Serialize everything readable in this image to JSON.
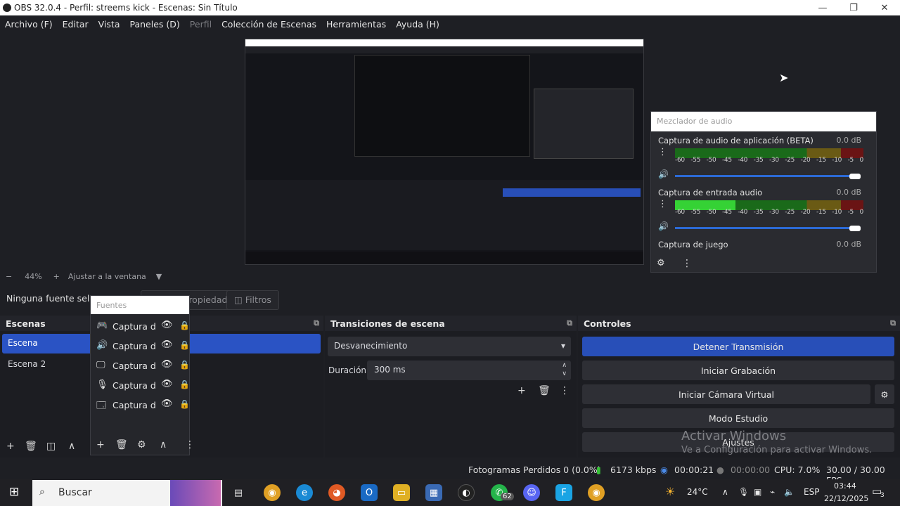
{
  "window": {
    "title": "OBS 32.0.4 - Perfil: streems kick - Escenas: Sin Título",
    "minimize": "—",
    "restore": "❐",
    "close": "✕"
  },
  "menu": [
    "Archivo (F)",
    "Editar",
    "Vista",
    "Paneles (D)",
    "Perfil",
    "Colección de Escenas",
    "Herramientas",
    "Ayuda (H)"
  ],
  "mixer": {
    "title": "Mezclador de audio",
    "channels": [
      {
        "name": "Captura de audio de aplicación (BETA)",
        "db": "0.0 dB",
        "level": 0.0
      },
      {
        "name": "Captura de entrada audio",
        "db": "0.0 dB",
        "level": 0.32
      },
      {
        "name": "Captura de juego",
        "db": "0.0 dB",
        "level": 0.0
      }
    ],
    "ticks": [
      "-60",
      "-55",
      "-50",
      "-45",
      "-40",
      "-35",
      "-30",
      "-25",
      "-20",
      "-15",
      "-10",
      "-5",
      "0"
    ]
  },
  "zoom": {
    "value": "44%",
    "fit": "Ajustar a la ventana"
  },
  "source_bar": {
    "label": "Ninguna fuente selec",
    "properties": "Propiedades",
    "filters": "Filtros"
  },
  "fuentes": {
    "placeholder": "Fuentes",
    "items": [
      {
        "name": "Captura d",
        "icon": "gamepad"
      },
      {
        "name": "Captura d",
        "icon": "speaker"
      },
      {
        "name": "Captura d",
        "icon": "monitor"
      },
      {
        "name": "Captura d",
        "icon": "microphone"
      },
      {
        "name": "Captura d",
        "icon": "window"
      }
    ]
  },
  "scenes": {
    "title": "Escenas",
    "items": [
      "Escena",
      "Escena 2"
    ]
  },
  "transitions": {
    "title": "Transiciones de escena",
    "selected": "Desvanecimiento",
    "duration_label": "Duración",
    "duration": "300 ms"
  },
  "controls": {
    "title": "Controles",
    "stop_stream": "Detener Transmisión",
    "start_rec": "Iniciar Grabación",
    "virtual_cam": "Iniciar Cámara Virtual",
    "studio": "Modo Estudio",
    "settings": "Ajustes"
  },
  "watermark": {
    "line1": "Activar Windows",
    "line2": "Ve a Configuración para activar Windows."
  },
  "status": {
    "frames": "Fotogramas Perdidos 0 (0.0%)",
    "kbps": "6173 kbps",
    "stream_time": "00:00:21",
    "rec_time": "00:00:00",
    "cpu": "CPU: 7.0%",
    "fps": "30.00 / 30.00 FPS"
  },
  "taskbar": {
    "search": "Buscar",
    "temp": "24°C",
    "lang": "ESP",
    "time": "03:44",
    "date": "22/12/2025",
    "badge_whatsapp": "62",
    "badge_notif": "3"
  },
  "colors": {
    "accent": "#284fb8",
    "scene_selected": "#2a53c4"
  }
}
